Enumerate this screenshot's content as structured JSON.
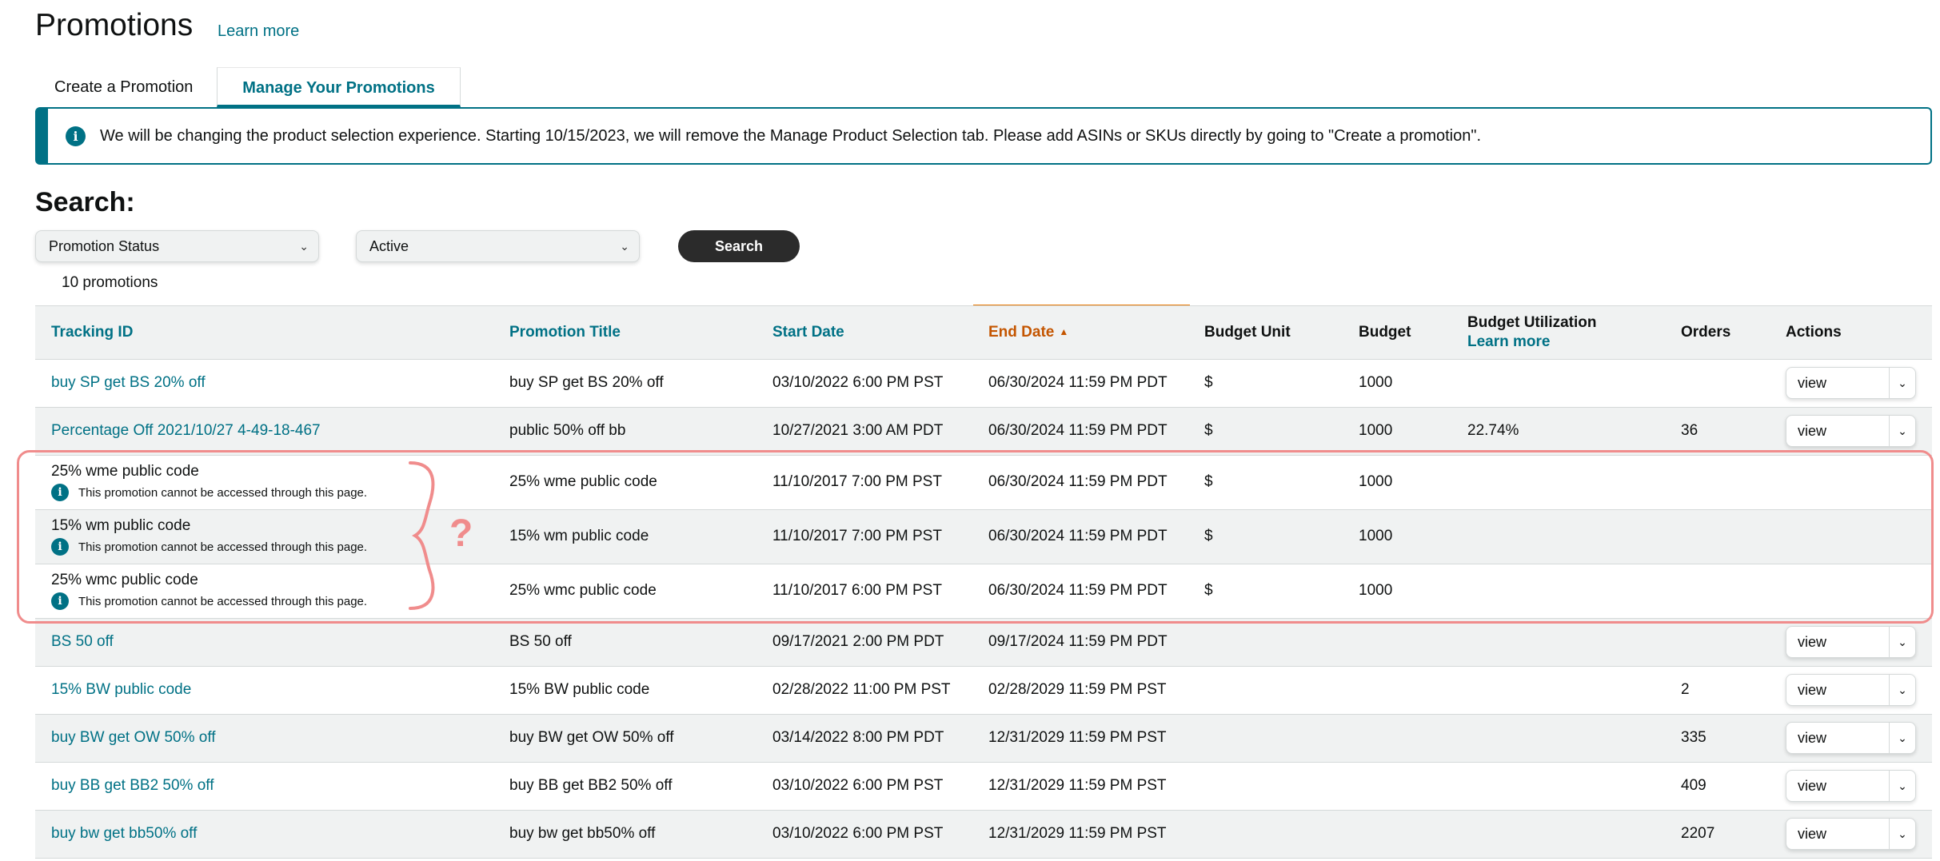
{
  "header": {
    "title": "Promotions",
    "learn_more": "Learn more"
  },
  "tabs": [
    {
      "label": "Create a Promotion"
    },
    {
      "label": "Manage Your Promotions"
    }
  ],
  "alert": {
    "icon": "info-icon",
    "text": "We will be changing the product selection experience. Starting 10/15/2023, we will remove the Manage Product Selection tab. Please add ASINs or SKUs directly by going to \"Create a promotion\"."
  },
  "search": {
    "heading": "Search:",
    "filter_field": "Promotion Status",
    "filter_value": "Active",
    "button": "Search",
    "result_count": "10 promotions"
  },
  "table": {
    "headers": {
      "tracking_id": "Tracking ID",
      "promotion_title": "Promotion Title",
      "start_date": "Start Date",
      "end_date": "End Date",
      "budget_unit": "Budget Unit",
      "budget": "Budget",
      "budget_utilization": "Budget Utilization",
      "budget_utilization_link": "Learn more",
      "orders": "Orders",
      "actions": "Actions"
    },
    "sort": {
      "column": "End Date",
      "direction": "ascending"
    },
    "action_label": "view",
    "inaccessible_note": "This promotion cannot be accessed through this page.",
    "rows": [
      {
        "tracking_id": "buy SP get BS 20% off",
        "title": "buy SP get BS 20% off",
        "start": "03/10/2022 6:00 PM PST",
        "end": "06/30/2024 11:59 PM PDT",
        "unit": "$",
        "budget": "1000",
        "utilization": "",
        "orders": ""
      },
      {
        "tracking_id": "Percentage Off 2021/10/27 4-49-18-467",
        "title": "public 50% off bb",
        "start": "10/27/2021 3:00 AM PDT",
        "end": "06/30/2024 11:59 PM PDT",
        "unit": "$",
        "budget": "1000",
        "utilization": "22.74%",
        "orders": "36"
      },
      {
        "tracking_id": "25% wme public code",
        "title": "25% wme public code",
        "start": "11/10/2017 7:00 PM PST",
        "end": "06/30/2024 11:59 PM PDT",
        "unit": "$",
        "budget": "1000",
        "utilization": "",
        "orders": ""
      },
      {
        "tracking_id": "15% wm public code",
        "title": "15% wm public code",
        "start": "11/10/2017 7:00 PM PST",
        "end": "06/30/2024 11:59 PM PDT",
        "unit": "$",
        "budget": "1000",
        "utilization": "",
        "orders": ""
      },
      {
        "tracking_id": "25% wmc public code",
        "title": "25% wmc public code",
        "start": "11/10/2017 6:00 PM PST",
        "end": "06/30/2024 11:59 PM PDT",
        "unit": "$",
        "budget": "1000",
        "utilization": "",
        "orders": ""
      },
      {
        "tracking_id": "BS 50 off",
        "title": "BS 50 off",
        "start": "09/17/2021 2:00 PM PDT",
        "end": "09/17/2024 11:59 PM PDT",
        "unit": "",
        "budget": "",
        "utilization": "",
        "orders": ""
      },
      {
        "tracking_id": "15% BW public code",
        "title": "15% BW public code",
        "start": "02/28/2022 11:00 PM PST",
        "end": "02/28/2029 11:59 PM PST",
        "unit": "",
        "budget": "",
        "utilization": "",
        "orders": "2"
      },
      {
        "tracking_id": "buy BW get OW 50% off",
        "title": "buy BW get OW 50% off",
        "start": "03/14/2022 8:00 PM PDT",
        "end": "12/31/2029 11:59 PM PST",
        "unit": "",
        "budget": "",
        "utilization": "",
        "orders": "335"
      },
      {
        "tracking_id": "buy BB get BB2 50% off",
        "title": "buy BB get BB2 50% off",
        "start": "03/10/2022 6:00 PM PST",
        "end": "12/31/2029 11:59 PM PST",
        "unit": "",
        "budget": "",
        "utilization": "",
        "orders": "409"
      },
      {
        "tracking_id": "buy bw get bb50% off",
        "title": "buy bw get bb50% off",
        "start": "03/10/2022 6:00 PM PST",
        "end": "12/31/2029 11:59 PM PST",
        "unit": "",
        "budget": "",
        "utilization": "",
        "orders": "2207"
      }
    ]
  },
  "annotation": {
    "symbol": "?",
    "color": "#f08c8c"
  },
  "colors": {
    "link": "#007185",
    "sort_active": "#c45500",
    "header_bg": "#f0f2f2",
    "alert_border": "#007185"
  }
}
